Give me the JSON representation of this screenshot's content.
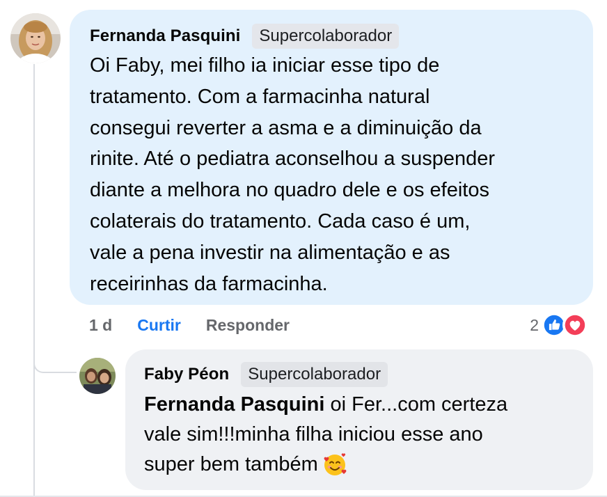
{
  "comment": {
    "author": "Fernanda Pasquini",
    "badge": "Supercolaborador",
    "text_lines": [
      "Oi Faby, mei filho ia iniciar esse tipo de",
      "tratamento. Com a farmacinha natural",
      "consegui reverter a asma e a diminuição da",
      "rinite. Até o pediatra aconselhou a suspender",
      "diante a melhora no quadro dele e os efeitos",
      "colaterais do tratamento. Cada caso é um,",
      "vale a pena investir na alimentação e as",
      "receirinhas da farmacinha."
    ],
    "time": "1 d",
    "like_label": "Curtir",
    "reply_label": "Responder",
    "reaction_count": "2",
    "reactions": [
      "like-icon",
      "love-icon"
    ]
  },
  "reply": {
    "author": "Faby Péon",
    "badge": "Supercolaborador",
    "mention": "Fernanda Pasquini",
    "text_line1": " oi Fer...com certeza",
    "text_line2": "vale sim!!!minha filha iniciou esse ano",
    "text_line3": "super bem também",
    "emoji": "smiling-face-with-hearts-icon"
  },
  "colors": {
    "comment_bubble": "#e3f1fd",
    "reply_bubble": "#eff1f4",
    "link_blue": "#1877f2",
    "like_blue": "#1877f2",
    "love_red": "#f33e58"
  }
}
